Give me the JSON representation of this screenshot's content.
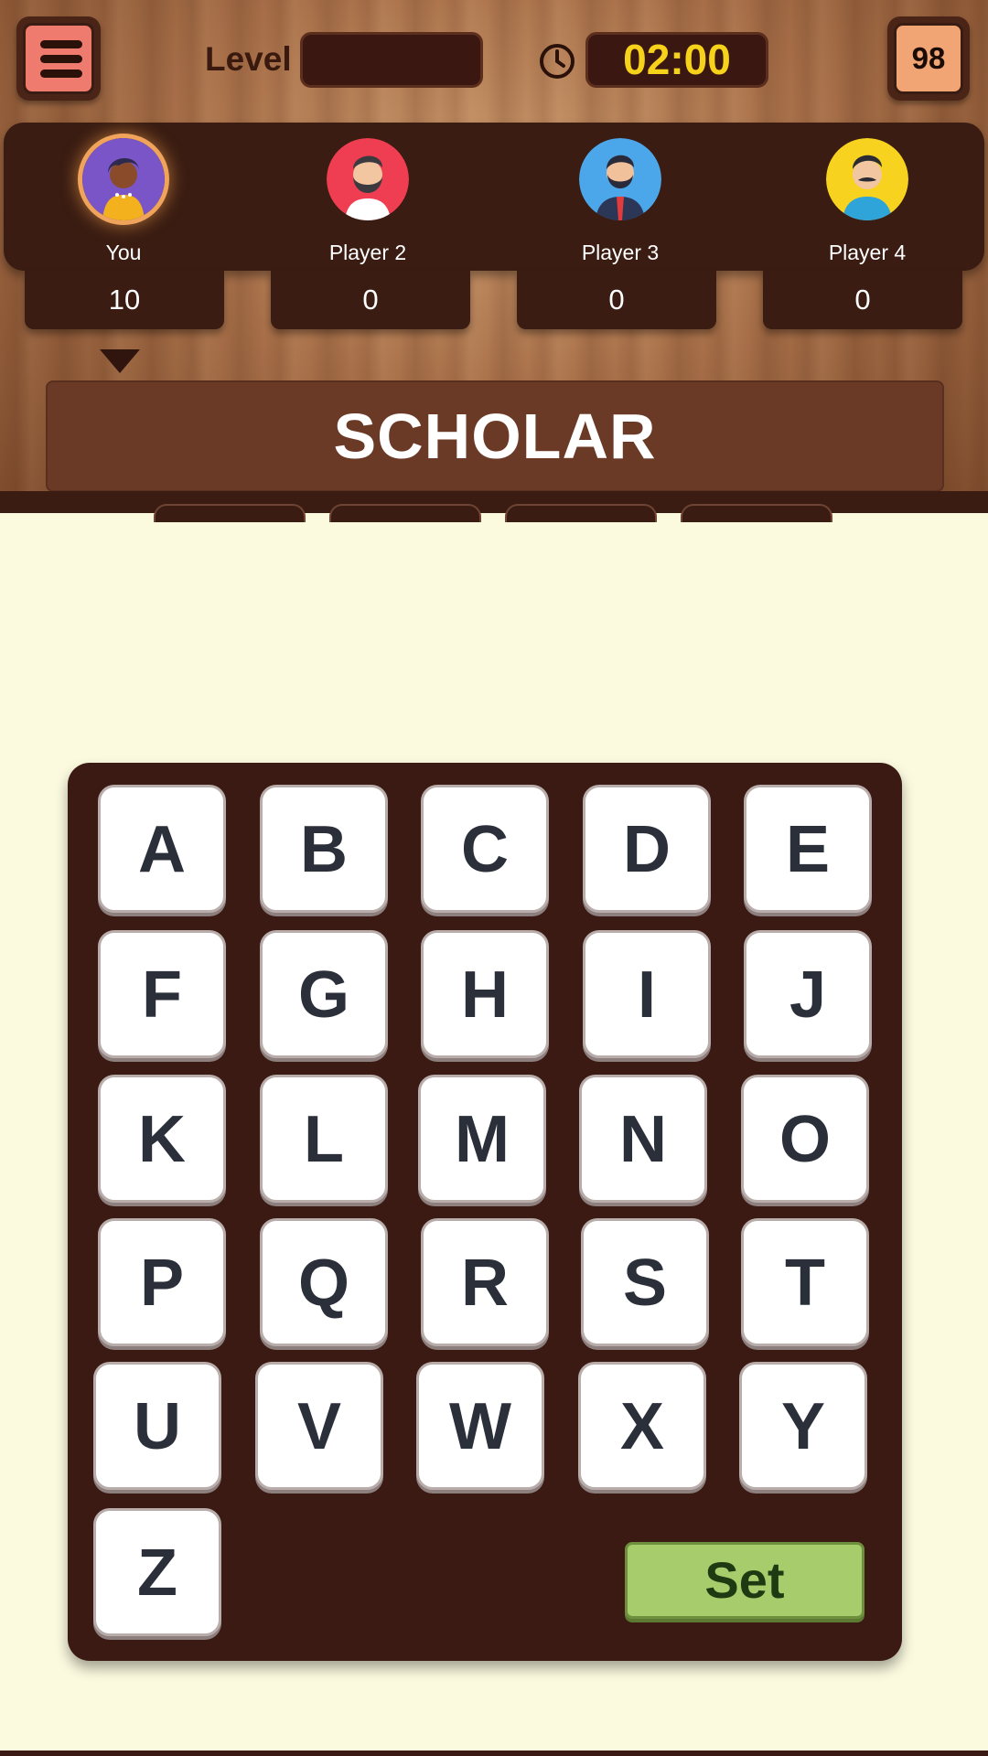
{
  "header": {
    "level_label": "Level",
    "level_value": "",
    "timer": "02:00",
    "counter": "98"
  },
  "players": [
    {
      "name": "You",
      "score": "10",
      "active": true,
      "avatar_bg": "#7a55c8"
    },
    {
      "name": "Player 2",
      "score": "0",
      "active": false,
      "avatar_bg": "#ef3e52"
    },
    {
      "name": "Player 3",
      "score": "0",
      "active": false,
      "avatar_bg": "#4ba7ea"
    },
    {
      "name": "Player 4",
      "score": "0",
      "active": false,
      "avatar_bg": "#f7d320"
    }
  ],
  "word": "SCHOLAR",
  "keyboard": {
    "letters": [
      "A",
      "B",
      "C",
      "D",
      "E",
      "F",
      "G",
      "H",
      "I",
      "J",
      "K",
      "L",
      "M",
      "N",
      "O",
      "P",
      "Q",
      "R",
      "S",
      "T",
      "U",
      "V",
      "W",
      "X",
      "Y",
      "Z"
    ],
    "set_label": "Set"
  },
  "colors": {
    "wood": "#a9714a",
    "panel": "#3a1c12",
    "timer_text": "#f6d21a",
    "set_button": "#a6cc6c",
    "background": "#fbfadf"
  }
}
